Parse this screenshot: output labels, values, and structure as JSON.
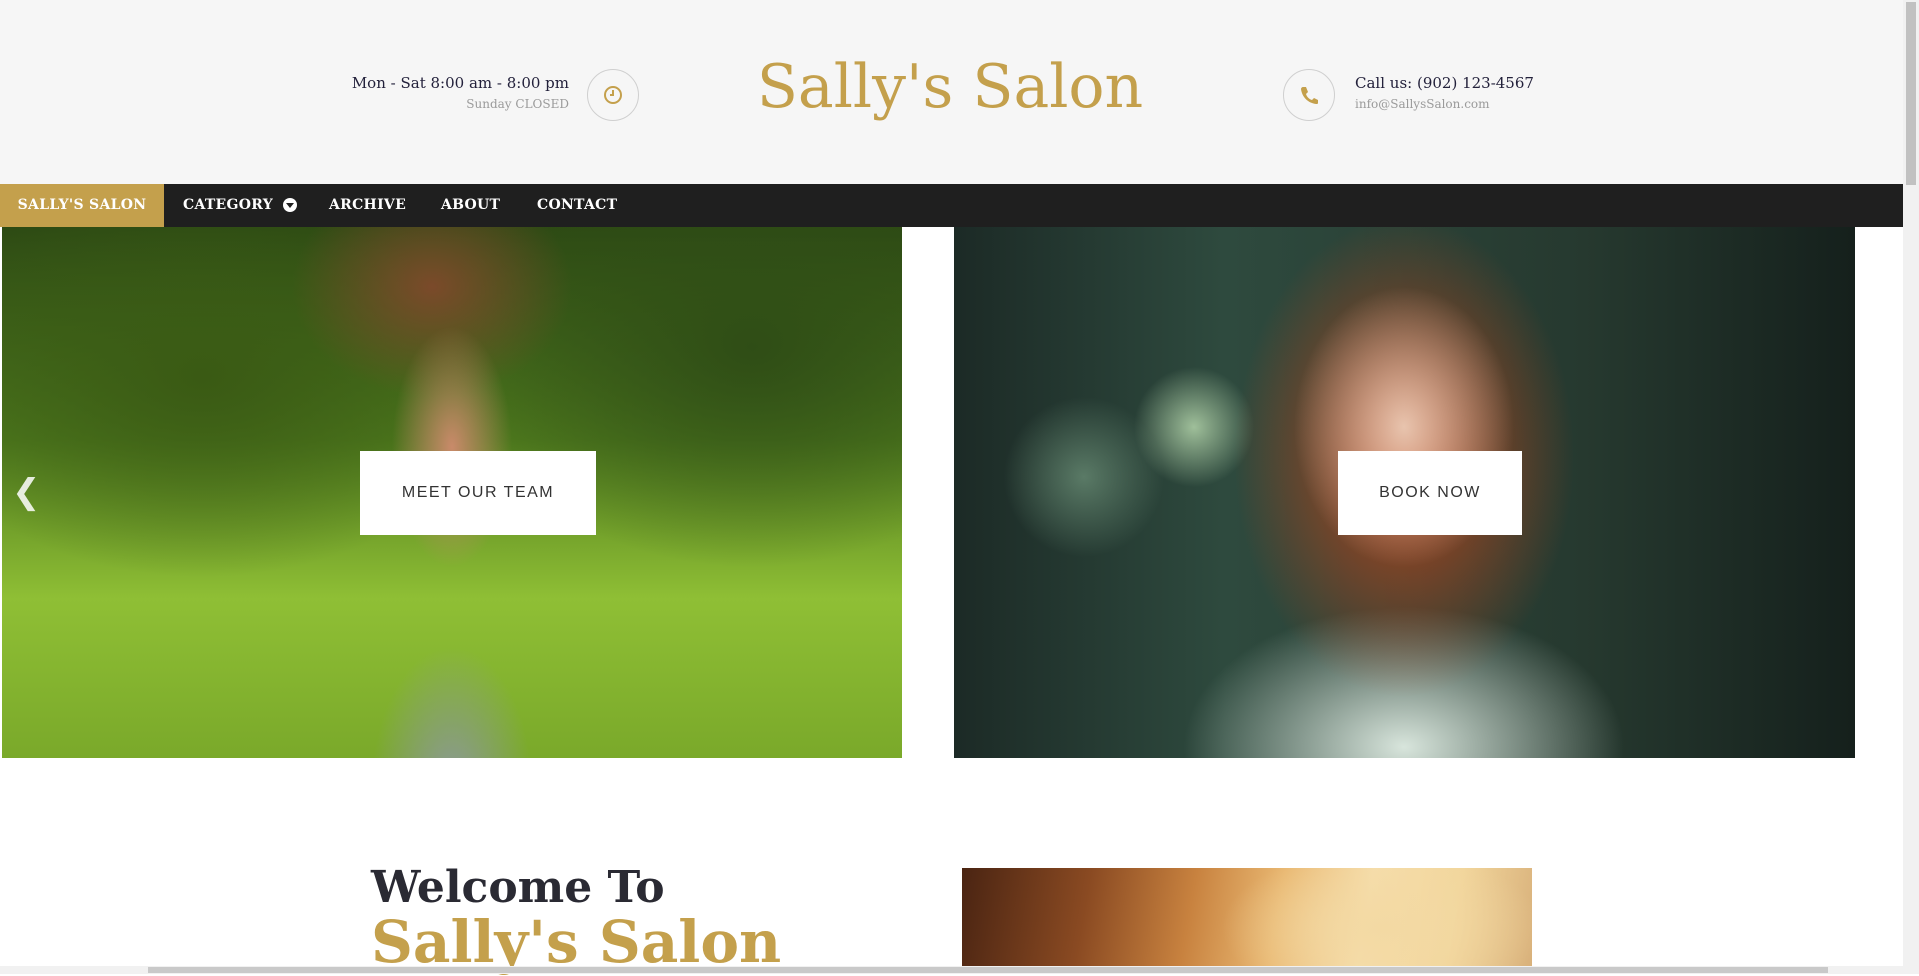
{
  "header": {
    "hours_main": "Mon - Sat 8:00 am - 8:00 pm",
    "hours_sub": "Sunday CLOSED",
    "brand": "Sally's Salon",
    "phone": "Call us: (902) 123-4567",
    "email": "info@SallysSalon.com",
    "icons": [
      "clock-icon",
      "phone-icon"
    ]
  },
  "nav": {
    "home": "SALLY'S SALON",
    "category": "CATEGORY",
    "archive": "ARCHIVE",
    "about": "ABOUT",
    "contact": "CONTACT"
  },
  "hero": {
    "team_button": "MEET OUR TEAM",
    "book_button": "BOOK NOW",
    "prev_icon": "chevron-left-icon"
  },
  "welcome": {
    "line1": "Welcome To",
    "line2": "Sally's Salon"
  },
  "colors": {
    "accent": "#c4a04c",
    "nav_bg": "#1f1f1f",
    "header_bg": "#f6f6f6"
  }
}
